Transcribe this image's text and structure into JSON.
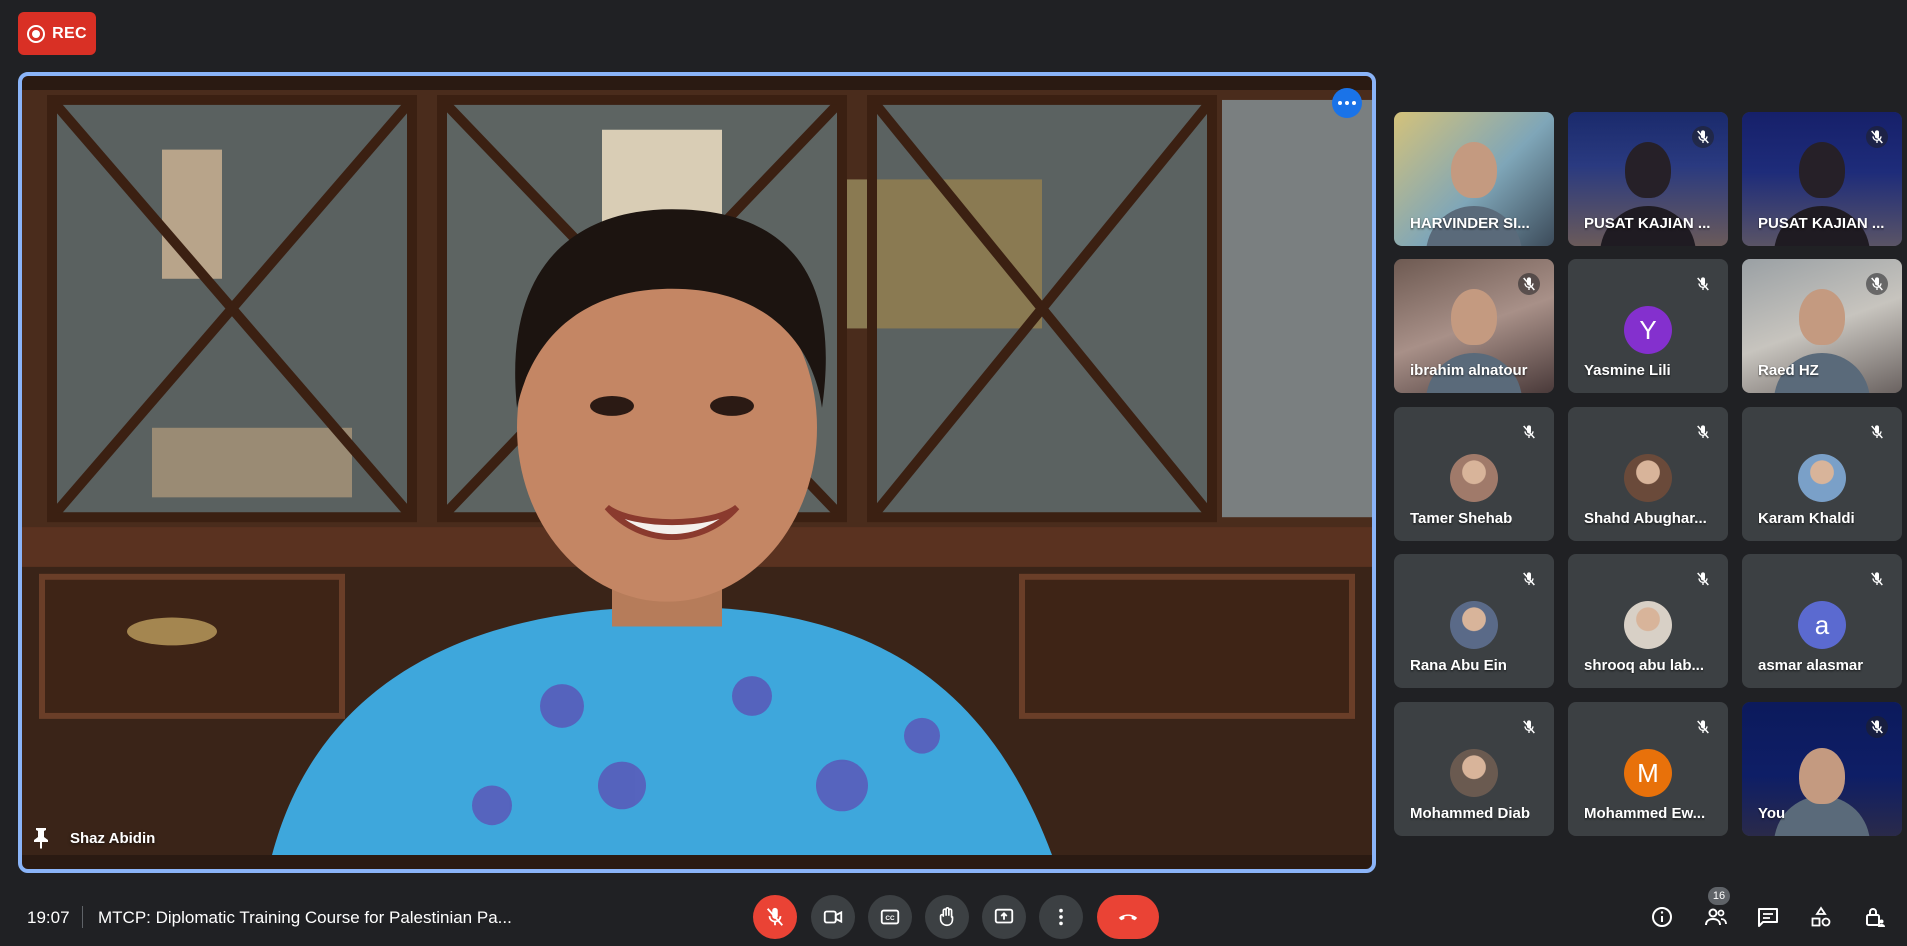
{
  "recording": {
    "label": "REC"
  },
  "main_speaker": {
    "name": "Shaz Abidin"
  },
  "participants": [
    {
      "name": "HARVINDER SI...",
      "kind": "video",
      "muted": false
    },
    {
      "name": "PUSAT KAJIAN ...",
      "kind": "video",
      "muted": true
    },
    {
      "name": "PUSAT KAJIAN ...",
      "kind": "video",
      "muted": true
    },
    {
      "name": "ibrahim alnatour",
      "kind": "video",
      "muted": true
    },
    {
      "name": "Yasmine Lili",
      "kind": "letter",
      "letter": "Y",
      "color": "#8430ce",
      "muted": true
    },
    {
      "name": "Raed HZ",
      "kind": "video",
      "muted": true
    },
    {
      "name": "Tamer Shehab",
      "kind": "photo",
      "muted": true
    },
    {
      "name": "Shahd Abughar...",
      "kind": "photo",
      "muted": true
    },
    {
      "name": "Karam Khaldi",
      "kind": "photo",
      "muted": true
    },
    {
      "name": "Rana Abu Ein",
      "kind": "photo",
      "muted": true
    },
    {
      "name": "shrooq abu lab...",
      "kind": "photo",
      "muted": true
    },
    {
      "name": "asmar alasmar",
      "kind": "letter",
      "letter": "a",
      "color": "#5b6ad0",
      "muted": true
    },
    {
      "name": "Mohammed Diab",
      "kind": "photo",
      "muted": true
    },
    {
      "name": "Mohammed Ew...",
      "kind": "letter",
      "letter": "M",
      "color": "#e8710a",
      "muted": true
    },
    {
      "name": "You",
      "kind": "video",
      "muted": true
    }
  ],
  "bottom_bar": {
    "time": "19:07",
    "meeting_title": "MTCP: Diplomatic Training Course for Palestinian Pa...",
    "participant_count": "16"
  },
  "colors": {
    "accent": "#8ab4f8",
    "danger": "#ea4335",
    "tile_bg": "#3c4043"
  }
}
